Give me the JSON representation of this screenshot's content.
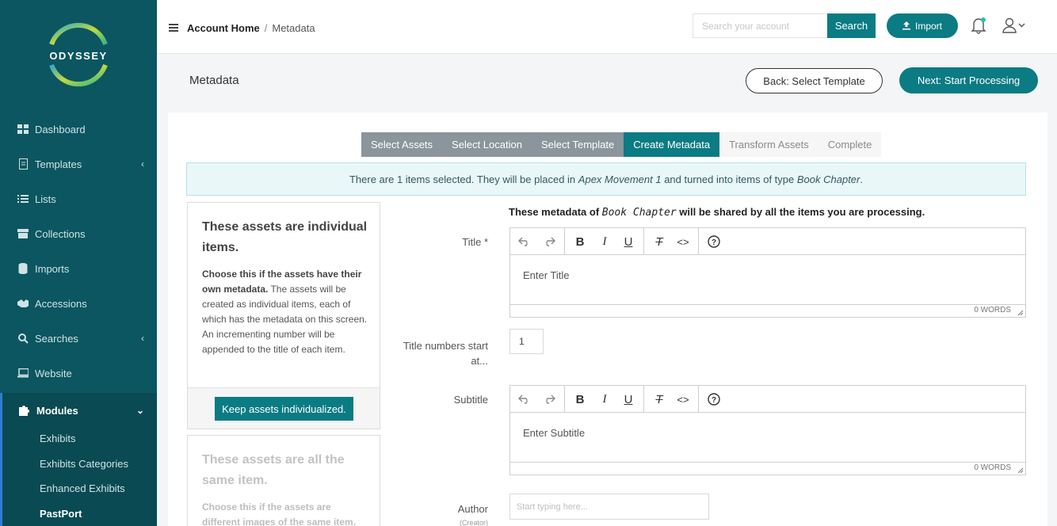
{
  "app": {
    "logo_text": "ODYSSEY"
  },
  "sidebar": {
    "items": [
      {
        "label": "Dashboard",
        "icon": "dashboard-icon"
      },
      {
        "label": "Templates",
        "icon": "document-icon",
        "has_chevron": true
      },
      {
        "label": "Lists",
        "icon": "list-icon"
      },
      {
        "label": "Collections",
        "icon": "box-icon"
      },
      {
        "label": "Imports",
        "icon": "database-icon"
      },
      {
        "label": "Accessions",
        "icon": "handshake-icon"
      },
      {
        "label": "Searches",
        "icon": "search-icon",
        "has_chevron": true
      },
      {
        "label": "Website",
        "icon": "laptop-icon"
      },
      {
        "label": "Modules",
        "icon": "puzzle-icon",
        "expanded": true
      }
    ],
    "sub_items": [
      {
        "label": "Exhibits"
      },
      {
        "label": "Exhibits Categories"
      },
      {
        "label": "Enhanced Exhibits"
      },
      {
        "label": "PastPort"
      }
    ]
  },
  "topbar": {
    "breadcrumb_home": "Account Home",
    "breadcrumb_sep": "/",
    "breadcrumb_current": "Metadata",
    "search_placeholder": "Search your account",
    "search_label": "Search",
    "import_label": "Import"
  },
  "page": {
    "title": "Metadata",
    "back_label": "Back: Select Template",
    "next_label": "Next: Start Processing"
  },
  "steps": [
    {
      "label": "Select Assets",
      "state": "done"
    },
    {
      "label": "Select Location",
      "state": "done"
    },
    {
      "label": "Select Template",
      "state": "done"
    },
    {
      "label": "Create Metadata",
      "state": "active"
    },
    {
      "label": "Transform Assets",
      "state": "todo"
    },
    {
      "label": "Complete",
      "state": "todo"
    }
  ],
  "info": {
    "prefix": "There are 1 items selected. They will be placed in ",
    "location": "Apex Movement 1",
    "middle": " and turned into items of type ",
    "type": "Book Chapter",
    "suffix": "."
  },
  "option_individual": {
    "title": "These assets are individual items.",
    "bold": "Choose this if the assets have their own metadata.",
    "desc": " The assets will be created as individual items, each of which has the metadata on this screen. An incrementing number will be appended to the title of each item.",
    "button": "Keep assets individualized."
  },
  "option_same": {
    "title": "These assets are all the same item.",
    "bold": "Choose this if the assets are different images of the same item."
  },
  "form": {
    "shared_prefix": "These metadata of ",
    "shared_type": "Book Chapter",
    "shared_suffix": " will be shared by all the items you are processing.",
    "title_label": "Title *",
    "title_placeholder": "Enter Title",
    "title_words": "0 WORDS",
    "title_numbers_label": "Title numbers start at...",
    "title_numbers_value": "1",
    "subtitle_label": "Subtitle",
    "subtitle_placeholder": "Enter Subtitle",
    "subtitle_words": "0 WORDS",
    "author_label": "Author",
    "author_sublabel": "(Creator)",
    "author_placeholder": "Start typing here..."
  },
  "colors": {
    "sidebar": "#0b5660",
    "accent": "#0b7b84",
    "step_done": "#8a959c"
  }
}
